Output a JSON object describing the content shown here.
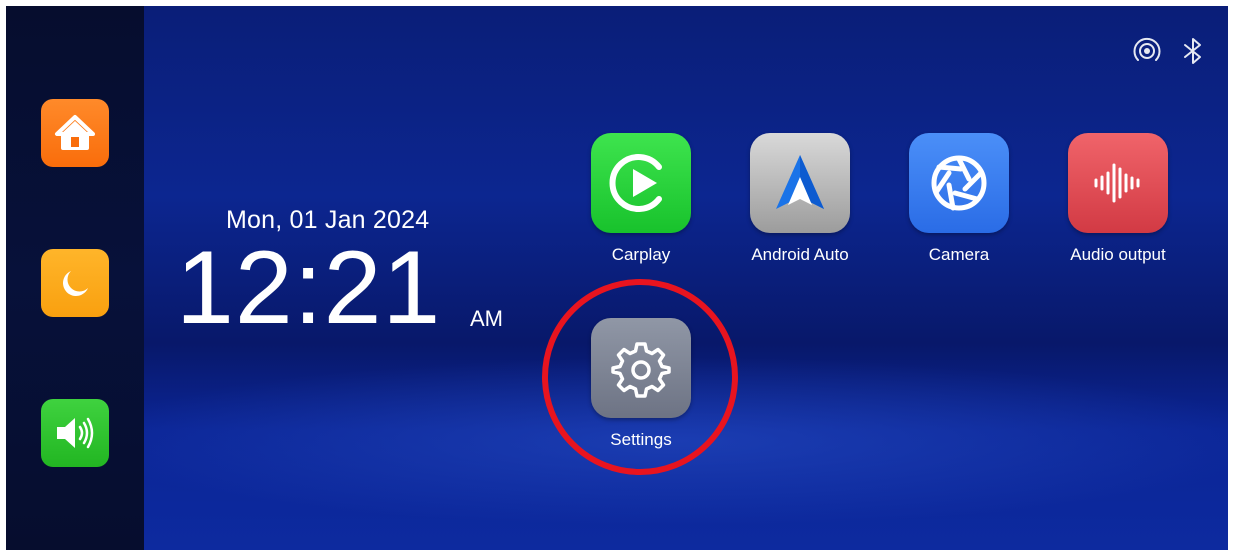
{
  "sidebar": {
    "buttons": [
      {
        "icon": "home-icon",
        "color": "#f96d0b"
      },
      {
        "icon": "moon-icon",
        "color": "#f9a00f"
      },
      {
        "icon": "speaker-icon",
        "color": "#22b622"
      }
    ]
  },
  "status_bar": {
    "icons": [
      "wireless-signal-icon",
      "bluetooth-icon"
    ]
  },
  "clock": {
    "date": "Mon, 01 Jan 2024",
    "time": "12:21",
    "ampm": "AM"
  },
  "apps": [
    {
      "label": "Carplay",
      "icon": "carplay-play-icon",
      "color": "#18c22c"
    },
    {
      "label": "Android Auto",
      "icon": "android-auto-icon",
      "color": "#9c9c9c"
    },
    {
      "label": "Camera",
      "icon": "camera-shutter-icon",
      "color": "#2a6ce6"
    },
    {
      "label": "Audio output",
      "icon": "sound-wave-icon",
      "color": "#d23a44"
    },
    {
      "label": "Settings",
      "icon": "gear-icon",
      "color": "#6d7384"
    }
  ],
  "highlight": {
    "target": "Settings",
    "color": "#e8141f"
  }
}
